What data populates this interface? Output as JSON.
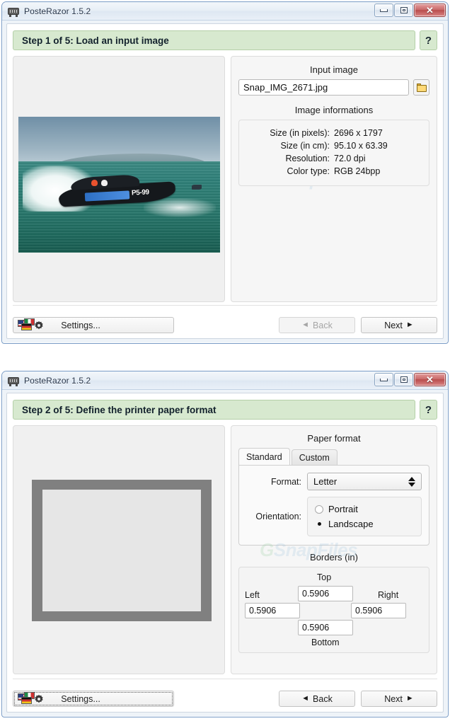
{
  "app": {
    "title": "PosteRazor 1.5.2",
    "icon": "printer-icon",
    "window_controls": {
      "minimize": "minimize-icon",
      "maximize": "maximize-icon",
      "close": "close-icon"
    }
  },
  "watermark": {
    "prefix": "G",
    "text": "SnapFiles"
  },
  "window1": {
    "title": "PosteRazor 1.5.2",
    "step_banner": "Step 1 of 5: Load an input image",
    "help_label": "?",
    "input_image": {
      "group_label": "Input image",
      "filename": "Snap_IMG_2671.jpg",
      "placeholder": "",
      "browse_icon": "folder-icon"
    },
    "image_info": {
      "group_label": "Image informations",
      "rows": [
        {
          "key": "Size (in pixels):",
          "value": "2696 x 1797"
        },
        {
          "key": "Size (in cm):",
          "value": "95.10 x 63.39"
        },
        {
          "key": "Resolution:",
          "value": "72.0 dpi"
        },
        {
          "key": "Color type:",
          "value": "RGB 24bpp"
        }
      ]
    },
    "preview": {
      "alt": "racing powerboat photo",
      "boat_number": "P5-99"
    },
    "footer": {
      "settings_label": "Settings...",
      "back_label": "Back",
      "back_enabled": false,
      "next_label": "Next",
      "next_enabled": true
    }
  },
  "window2": {
    "title": "PosteRazor 1.5.2",
    "step_banner": "Step 2 of 5: Define the printer paper format",
    "help_label": "?",
    "paper_format": {
      "group_label": "Paper format",
      "tabs": [
        {
          "label": "Standard",
          "active": true
        },
        {
          "label": "Custom",
          "active": false
        }
      ],
      "format_label": "Format:",
      "format_value": "Letter",
      "orientation_label": "Orientation:",
      "orientation_options": [
        {
          "label": "Portrait",
          "selected": false
        },
        {
          "label": "Landscape",
          "selected": true
        }
      ]
    },
    "borders": {
      "group_label": "Borders (in)",
      "top_label": "Top",
      "top_value": "0.5906",
      "left_label": "Left",
      "left_value": "0.5906",
      "right_label": "Right",
      "right_value": "0.5906",
      "bottom_label": "Bottom",
      "bottom_value": "0.5906"
    },
    "footer": {
      "settings_label": "Settings...",
      "back_label": "Back",
      "back_enabled": true,
      "next_label": "Next",
      "next_enabled": true
    }
  }
}
